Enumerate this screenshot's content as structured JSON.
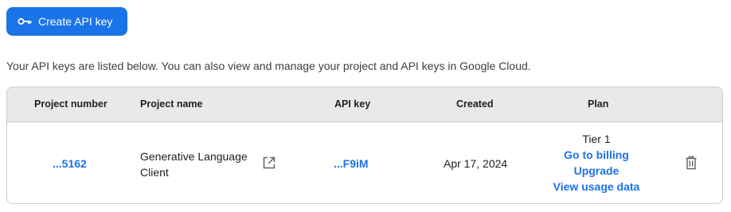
{
  "create_button": {
    "label": "Create API key",
    "icon": "key-icon"
  },
  "intro_text": "Your API keys are listed below. You can also view and manage your project and API keys in Google Cloud.",
  "table": {
    "headers": {
      "project_number": "Project number",
      "project_name": "Project name",
      "api_key": "API key",
      "created": "Created",
      "plan": "Plan"
    },
    "rows": [
      {
        "project_number": "...5162",
        "project_name_line1": "Generative Language",
        "project_name_line2": "Client",
        "open_icon": "open-in-new-icon",
        "api_key": "...F9iM",
        "created": "Apr 17, 2024",
        "plan_tier": "Tier 1",
        "plan_links": [
          "Go to billing",
          "Upgrade",
          "View usage data"
        ],
        "delete_icon": "trash-icon"
      }
    ]
  },
  "colors": {
    "accent": "#1a73e8",
    "header_bg": "#e8e9eb",
    "border": "#c9cbcf"
  }
}
